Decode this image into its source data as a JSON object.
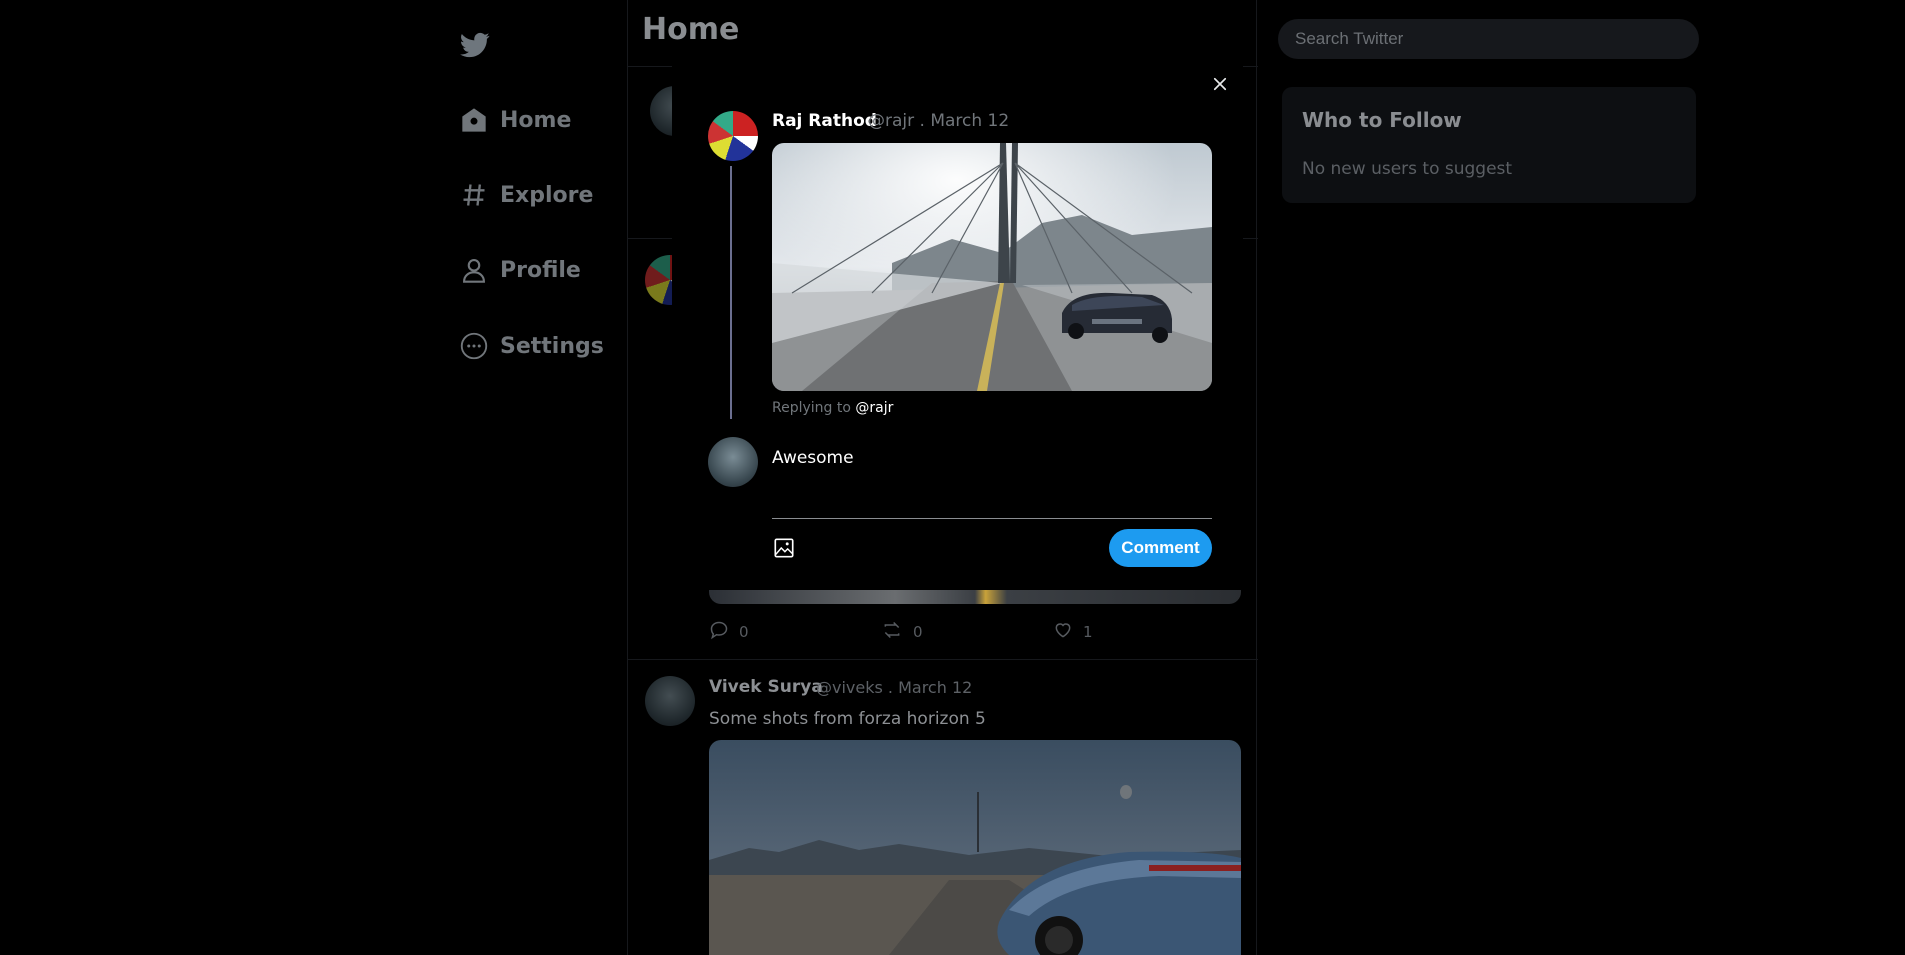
{
  "sidebar": {
    "items": [
      {
        "label": "Home"
      },
      {
        "label": "Explore"
      },
      {
        "label": "Profile"
      },
      {
        "label": "Settings"
      }
    ]
  },
  "main": {
    "title": "Home",
    "posts": [
      {
        "stats": {
          "comments": "0",
          "retweets": "0",
          "likes": "1"
        }
      },
      {
        "name": "Vivek Surya",
        "meta": "@viveks . March 12",
        "text": "Some shots from forza horizon 5"
      }
    ]
  },
  "rightbar": {
    "search_placeholder": "Search Twitter",
    "follow_title": "Who to Follow",
    "follow_empty": "No new users to suggest"
  },
  "modal": {
    "author_name": "Raj Rathod",
    "author_meta": "@rajr . March 12",
    "replying_prefix": "Replying to",
    "replying_handle": "@rajr",
    "reply_value": "Awesome",
    "comment_label": "Comment"
  },
  "icons": [
    "twitter-logo-icon",
    "home-icon",
    "hashtag-icon",
    "profile-icon",
    "settings-icon",
    "close-icon",
    "image-icon",
    "comment-icon",
    "retweet-icon",
    "heart-icon"
  ],
  "colors": {
    "accent": "#1d9bf0",
    "background": "#000000"
  }
}
